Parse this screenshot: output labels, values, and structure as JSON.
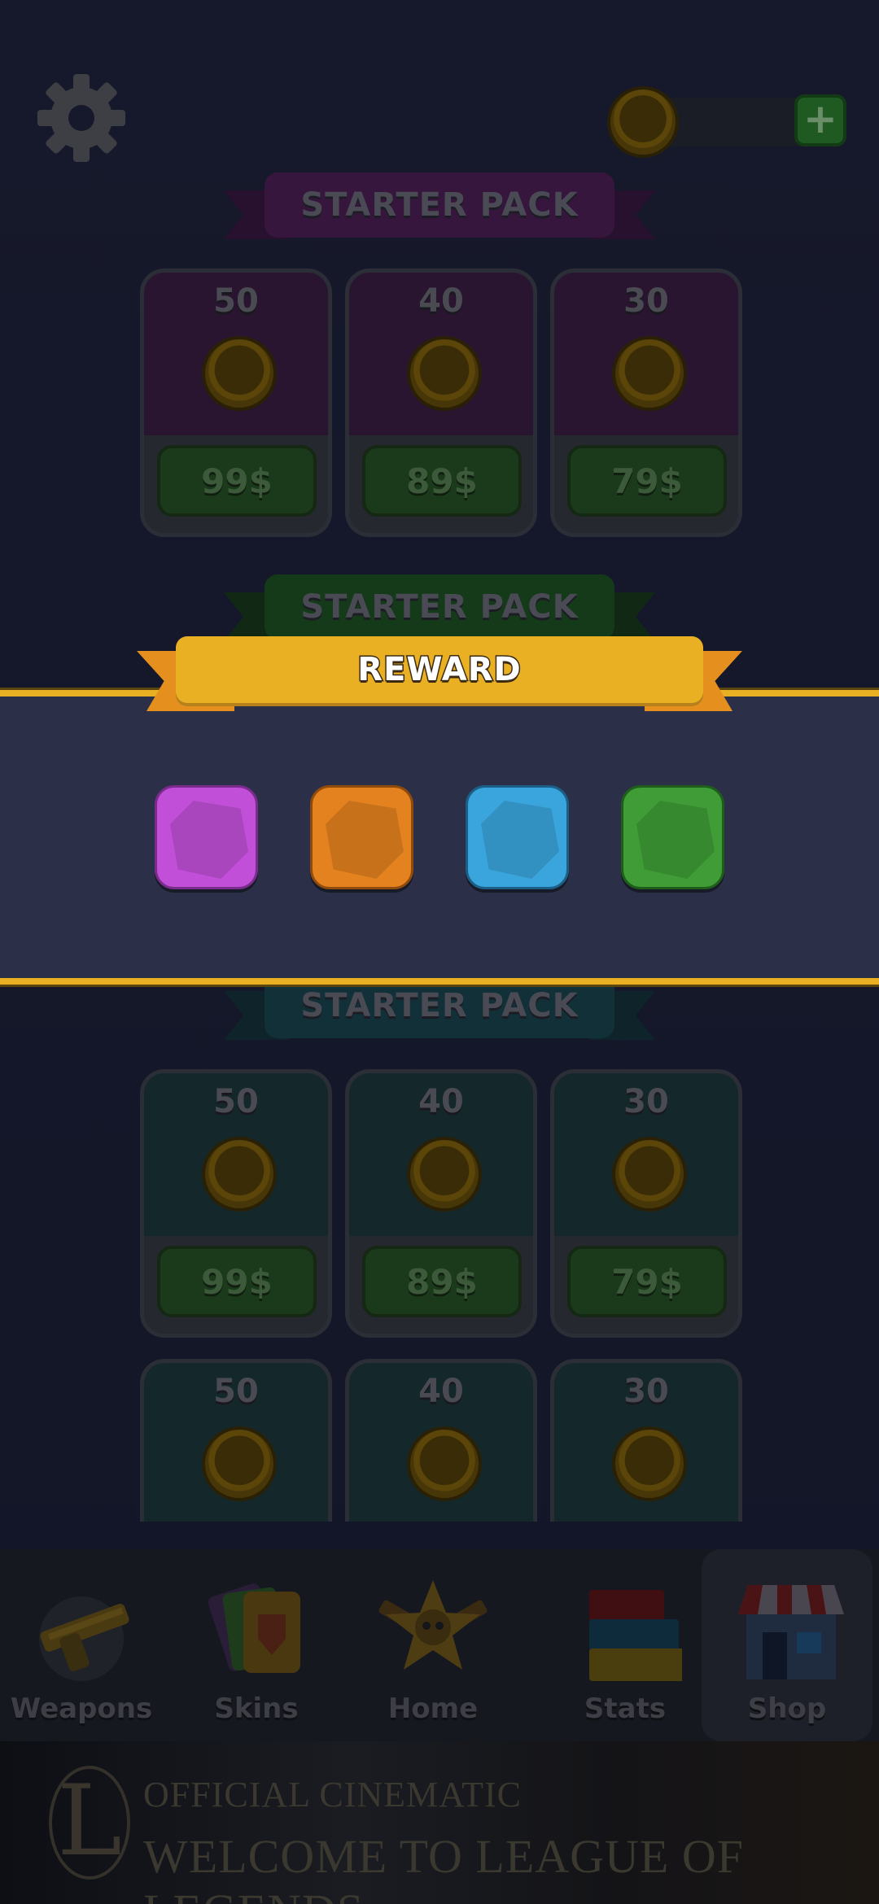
{
  "header": {
    "settings_icon": "gear-icon",
    "coin_icon": "coin-icon",
    "add_icon": "plus-icon",
    "add_label": "+"
  },
  "sections": [
    {
      "title": "STARTER PACK",
      "theme": "purple",
      "packs": [
        {
          "quantity": "50",
          "price": "99$"
        },
        {
          "quantity": "40",
          "price": "89$"
        },
        {
          "quantity": "30",
          "price": "79$"
        }
      ]
    },
    {
      "title": "STARTER PACK",
      "theme": "green"
    },
    {
      "title": "STARTER PACK",
      "theme": "teal",
      "packs": [
        {
          "quantity": "50",
          "price": "99$"
        },
        {
          "quantity": "40",
          "price": "89$"
        },
        {
          "quantity": "30",
          "price": "79$"
        }
      ],
      "extra_packs": [
        {
          "quantity": "50"
        },
        {
          "quantity": "40"
        },
        {
          "quantity": "30"
        }
      ]
    }
  ],
  "reward_modal": {
    "title": "REWARD",
    "gems": [
      {
        "name": "purple-gem",
        "color": "#c14fd8"
      },
      {
        "name": "orange-gem",
        "color": "#e3821f"
      },
      {
        "name": "blue-gem",
        "color": "#3aa5dc"
      },
      {
        "name": "green-gem",
        "color": "#3f9c36"
      }
    ]
  },
  "bottom_nav": {
    "items": [
      {
        "label": "Weapons",
        "icon": "gun-icon",
        "active": false
      },
      {
        "label": "Skins",
        "icon": "cards-icon",
        "active": false
      },
      {
        "label": "Home",
        "icon": "skull-star-icon",
        "active": false
      },
      {
        "label": "Stats",
        "icon": "bars-icon",
        "active": false
      },
      {
        "label": "Shop",
        "icon": "store-icon",
        "active": true
      }
    ]
  },
  "ad_banner": {
    "logo_letter": "L",
    "line1": "OFFICIAL CINEMATIC",
    "line2": "WELCOME TO LEAGUE OF LEGENDS"
  },
  "colors": {
    "accent_gold": "#e9b024",
    "modal_bg": "#2b3048"
  }
}
